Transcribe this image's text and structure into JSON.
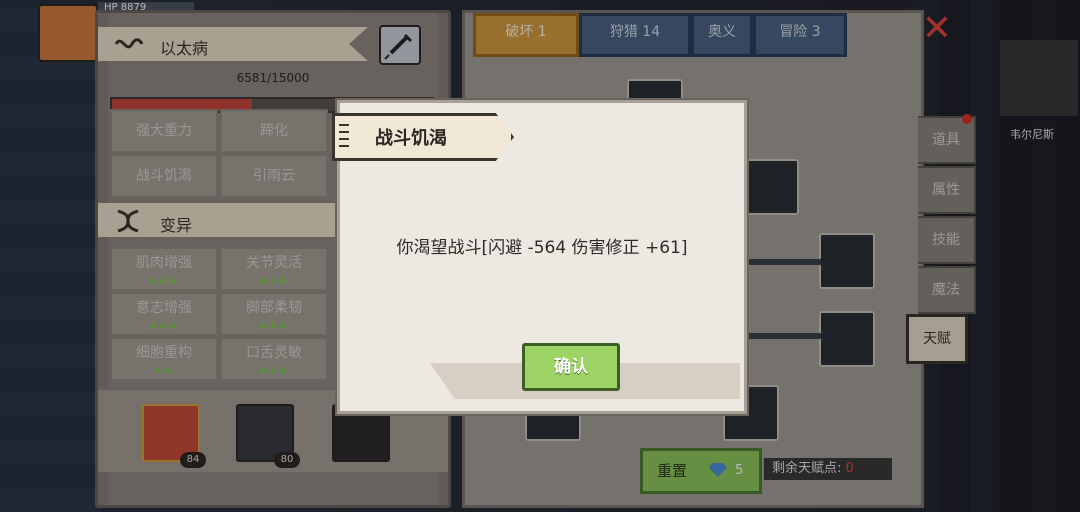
{
  "hud": {
    "hp_label": "HP",
    "hp_value": "8879",
    "minimap_label": "韦尔尼斯",
    "close_icon": "close-x-icon"
  },
  "left_panel": {
    "section1": {
      "title": "以太病",
      "progress_text": "6581/15000",
      "progress": 0.4387,
      "abilities": [
        "强大重力",
        "蹄化",
        "战斗饥渴",
        "引雨云"
      ]
    },
    "section2": {
      "title": "变异",
      "traits": [
        {
          "label": "肌肉增强",
          "level": "▲▲▲"
        },
        {
          "label": "关节灵活",
          "level": "▲▲▲"
        },
        {
          "label": "意志增强",
          "level": "▲▲▲"
        },
        {
          "label": "脚部柔韧",
          "level": "▲▲▲"
        },
        {
          "label": "细胞重构",
          "level": "▲▲"
        },
        {
          "label": "口舌灵敏",
          "level": "▲▲▲"
        }
      ]
    },
    "party": [
      {
        "level": "84"
      },
      {
        "level": "80"
      }
    ]
  },
  "right_panel": {
    "tabs": [
      {
        "label": "破坏 1"
      },
      {
        "label": "狩猎 14"
      },
      {
        "label": "奥义"
      },
      {
        "label": "冒险 3"
      }
    ],
    "side_tabs": [
      "道具",
      "属性",
      "技能",
      "魔法",
      "天赋"
    ],
    "reset_label": "重置",
    "reset_cost": "5",
    "remaining_label": "剩余天赋点:",
    "remaining_value": "0"
  },
  "modal": {
    "title": "战斗饥渴",
    "body": "你渴望战斗[闪避 -564 伤害修正 +61]",
    "confirm_label": "确认"
  },
  "colors": {
    "active_tab": "#d39a3d",
    "confirm_green": "#9ed466",
    "progress_red": "#c8453c",
    "close_red": "#e2463e"
  }
}
